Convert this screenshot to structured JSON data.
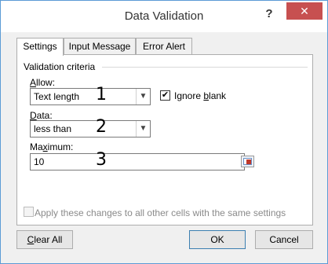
{
  "window": {
    "title": "Data Validation",
    "help_label": "?",
    "close_label": "✕"
  },
  "tabs": [
    {
      "label": "Settings"
    },
    {
      "label": "Input Message"
    },
    {
      "label": "Error Alert"
    }
  ],
  "settings": {
    "section_label": "Validation criteria",
    "allow": {
      "label_first": "A",
      "label_rest": "llow:",
      "value": "Text length",
      "marker": "1"
    },
    "ignore_blank": {
      "label_pre": "Ignore ",
      "label_key": "b",
      "label_post": "lank",
      "checked": true
    },
    "data": {
      "label_first": "D",
      "label_rest": "ata:",
      "value": "less than",
      "marker": "2"
    },
    "maximum": {
      "label_pre": "Ma",
      "label_key": "x",
      "label_post": "imum:",
      "value": "10",
      "marker": "3"
    },
    "apply_all": {
      "label": "Apply these changes to all other cells with the same settings",
      "checked": false,
      "enabled": false
    }
  },
  "buttons": {
    "clear_all_key": "C",
    "clear_all_rest": "lear All",
    "ok": "OK",
    "cancel": "Cancel"
  },
  "icons": {
    "dropdown": "chevron-down-icon",
    "range_select": "range-select-icon",
    "check": "✔"
  }
}
